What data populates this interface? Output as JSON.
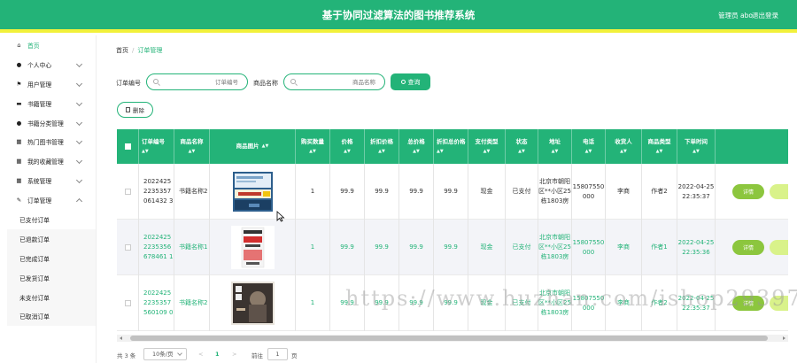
{
  "header": {
    "title": "基于协同过滤算法的图书推荐系统",
    "admin": "管理员 abo",
    "logout": "退出登录"
  },
  "sidebar": {
    "items": [
      {
        "label": "首页",
        "icon": "home-icon"
      },
      {
        "label": "个人中心",
        "icon": "user-icon"
      },
      {
        "label": "用户管理",
        "icon": "flag-icon"
      },
      {
        "label": "书籍管理",
        "icon": "book-icon"
      },
      {
        "label": "书籍分类管理",
        "icon": "user-icon"
      },
      {
        "label": "热门图书管理",
        "icon": "grid-icon"
      },
      {
        "label": "我的收藏管理",
        "icon": "grid-icon"
      },
      {
        "label": "系统管理",
        "icon": "grid-icon"
      },
      {
        "label": "订单管理",
        "icon": "pen-icon"
      }
    ],
    "subitems": [
      "已支付订单",
      "已退款订单",
      "已完成订单",
      "已发货订单",
      "未支付订单",
      "已取消订单"
    ]
  },
  "breadcrumb": {
    "home": "首页",
    "current": "订单管理"
  },
  "search": {
    "order_label": "订单编号",
    "order_placeholder": "订单编号",
    "product_label": "商品名称",
    "product_placeholder": "商品名称",
    "query_button": "查询"
  },
  "toolbar": {
    "delete_button": "删除"
  },
  "table": {
    "columns": [
      "订单编号",
      "商品名称",
      "商品图片",
      "购买数量",
      "价格",
      "折扣价格",
      "总价格",
      "折扣总价格",
      "支付类型",
      "状态",
      "地址",
      "电话",
      "收货人",
      "商品类型",
      "下单时间"
    ],
    "sort_icon": "▲▼",
    "rows": [
      {
        "order_no": "20224252235357061432 3",
        "product": "书籍名称2",
        "qty": "1",
        "price": "99.9",
        "disc_price": "99.9",
        "total": "99.9",
        "disc_total": "99.9",
        "pay": "现金",
        "status": "已支付",
        "address": "北京市朝阳区**小区25栋1803房",
        "phone": "15807550000",
        "receiver": "李商",
        "type": "作者2",
        "time": "2022-04-25 22:35:37",
        "op": "详情"
      },
      {
        "order_no": "20224252235356678461 1",
        "product": "书籍名称1",
        "qty": "1",
        "price": "99.9",
        "disc_price": "99.9",
        "total": "99.9",
        "disc_total": "99.9",
        "pay": "现金",
        "status": "已支付",
        "address": "北京市朝阳区**小区25栋1803房",
        "phone": "15807550000",
        "receiver": "李商",
        "type": "作者1",
        "time": "2022-04-25 22:35:36",
        "op": "详情"
      },
      {
        "order_no": "20224252235357560109 0",
        "product": "书籍名称2",
        "qty": "1",
        "price": "99.9",
        "disc_price": "99.9",
        "total": "99.9",
        "disc_total": "99.9",
        "pay": "现金",
        "status": "已支付",
        "address": "北京市朝阳区**小区25栋1803房",
        "phone": "15807550000",
        "receiver": "李商",
        "type": "作者2",
        "time": "2022-04-25 22:35:37",
        "op": "详情"
      }
    ]
  },
  "pagination": {
    "total": "共 3 条",
    "page_size": "10条/页",
    "prev": "<",
    "page": "1",
    "next": ">",
    "goto": "前往",
    "goto_value": "1",
    "page_suffix": "页"
  },
  "watermark": "https://www.huzhan.com/ishop29397",
  "colors": {
    "primary": "#23b378",
    "accent_bar": "#f2f13b",
    "op_button": "#8cc63e"
  }
}
